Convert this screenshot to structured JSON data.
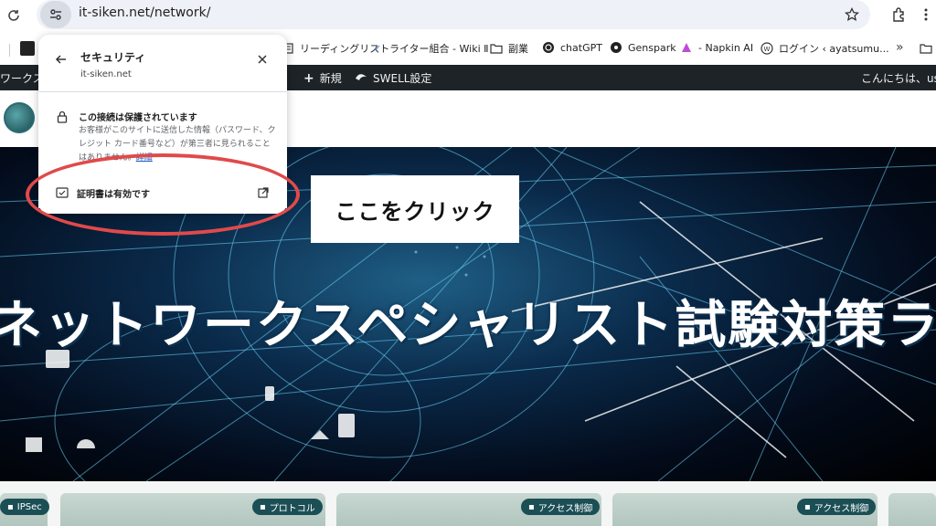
{
  "browser": {
    "url": "it-siken.net/network/"
  },
  "bookmarks": [
    {
      "label": "リーディングリスト"
    },
    {
      "label": "ライター組合 - Wiki Ⅱ"
    },
    {
      "label": "副業"
    },
    {
      "label": "chatGPT"
    },
    {
      "label": "Genspark"
    },
    {
      "label": "- Napkin AI"
    },
    {
      "label": "ログイン ‹ ayatsumu..."
    }
  ],
  "adminbar": {
    "left_fragment": "ワークス",
    "new_label": "新規",
    "swell_label": "SWELL設定",
    "greeting": "こんにちは、use"
  },
  "popup": {
    "title": "セキュリティ",
    "domain": "it-siken.net",
    "connection_title": "この接続は保護されています",
    "connection_desc": "お客様がこのサイトに送信した情報（パスワード、クレジット カード番号など）が第三者に見られることはありません。",
    "details_link": "詳細",
    "certificate_label": "証明書は有効です"
  },
  "annotation": {
    "text": "ここをクリック",
    "highlight_color": "#e04a4a"
  },
  "hero": {
    "title": "ネットワークスペシャリスト試験対策ラボ"
  },
  "cards": [
    {
      "tag": "IPSec"
    },
    {
      "tag": "プロトコル"
    },
    {
      "tag": "アクセス制御"
    },
    {
      "tag": "アクセス制御"
    }
  ],
  "colors": {
    "adminbar_bg": "#1d2327",
    "tag_bg": "#1b4f55",
    "omnibox_bg": "#eef1f7"
  }
}
